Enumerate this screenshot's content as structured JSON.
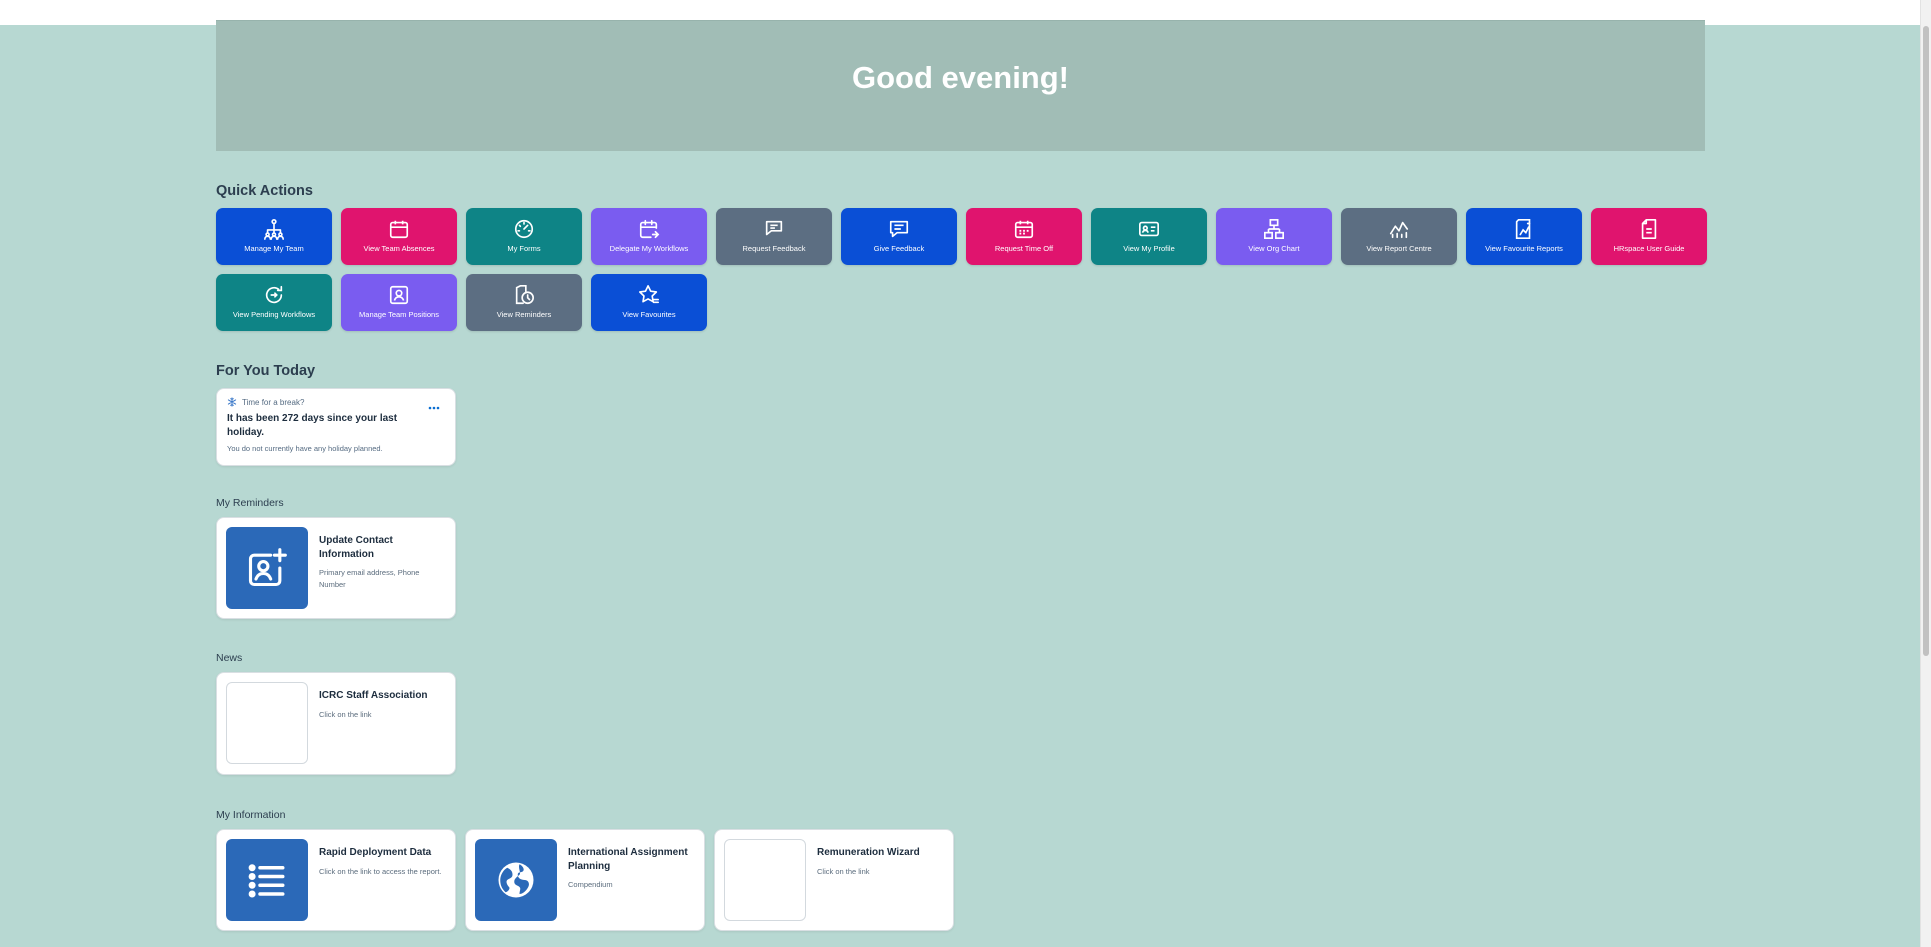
{
  "hero": {
    "greeting": "Good evening!"
  },
  "quick_actions": {
    "title": "Quick Actions",
    "items": [
      {
        "label": "Manage My Team",
        "icon": "org-team-icon",
        "color": "#0a4fd6"
      },
      {
        "label": "View Team Absences",
        "icon": "calendar-icon",
        "color": "#e0146e"
      },
      {
        "label": "My Forms",
        "icon": "dashboard-gauge-icon",
        "color": "#0e8486"
      },
      {
        "label": "Delegate My Workflows",
        "icon": "calendar-forward-icon",
        "color": "#7a5cf0"
      },
      {
        "label": "Request Feedback",
        "icon": "chat-bubbles-icon",
        "color": "#5c6e82"
      },
      {
        "label": "Give Feedback",
        "icon": "message-icon",
        "color": "#0a4fd6"
      },
      {
        "label": "Request Time Off",
        "icon": "calendar-grid-icon",
        "color": "#e0146e"
      },
      {
        "label": "View My Profile",
        "icon": "id-card-icon",
        "color": "#0e8486"
      },
      {
        "label": "View Org Chart",
        "icon": "org-chart-icon",
        "color": "#7a5cf0"
      },
      {
        "label": "View Report Centre",
        "icon": "line-chart-icon",
        "color": "#5c6e82"
      },
      {
        "label": "View Favourite Reports",
        "icon": "report-icon",
        "color": "#0a4fd6"
      },
      {
        "label": "HRspace User Guide",
        "icon": "document-icon",
        "color": "#e0146e"
      },
      {
        "label": "View Pending Workflows",
        "icon": "refresh-pending-icon",
        "color": "#0e8486"
      },
      {
        "label": "Manage Team Positions",
        "icon": "person-frame-icon",
        "color": "#7a5cf0"
      },
      {
        "label": "View Reminders",
        "icon": "reminder-clock-icon",
        "color": "#5c6e82"
      },
      {
        "label": "View Favourites",
        "icon": "star-list-icon",
        "color": "#0a4fd6"
      }
    ]
  },
  "for_you_today": {
    "title": "For You Today",
    "card": {
      "header": "Time for a break?",
      "title": "It has been 272 days since your last holiday.",
      "subtitle": "You do not currently have any holiday planned.",
      "icon": "snowflake-icon"
    }
  },
  "my_reminders": {
    "title": "My Reminders",
    "tiles": [
      {
        "title": "Update Contact Information",
        "desc": "Primary email address, Phone Number",
        "icon": "add-contact-icon"
      }
    ]
  },
  "news": {
    "title": "News",
    "tiles": [
      {
        "title": "ICRC Staff Association",
        "desc": "Click on the link"
      }
    ]
  },
  "my_information": {
    "title": "My Information",
    "tiles": [
      {
        "title": "Rapid Deployment Data",
        "desc": "Click on the link to access the report.",
        "icon": "list-icon"
      },
      {
        "title": "International Assignment Planning",
        "desc": "Compendium",
        "icon": "globe-icon"
      },
      {
        "title": "Remuneration Wizard",
        "desc": "Click on the link"
      }
    ]
  },
  "colors": {
    "background": "#b7d8d2",
    "hero": "#a1bdb6",
    "tile_blue": "#2b69b8"
  }
}
